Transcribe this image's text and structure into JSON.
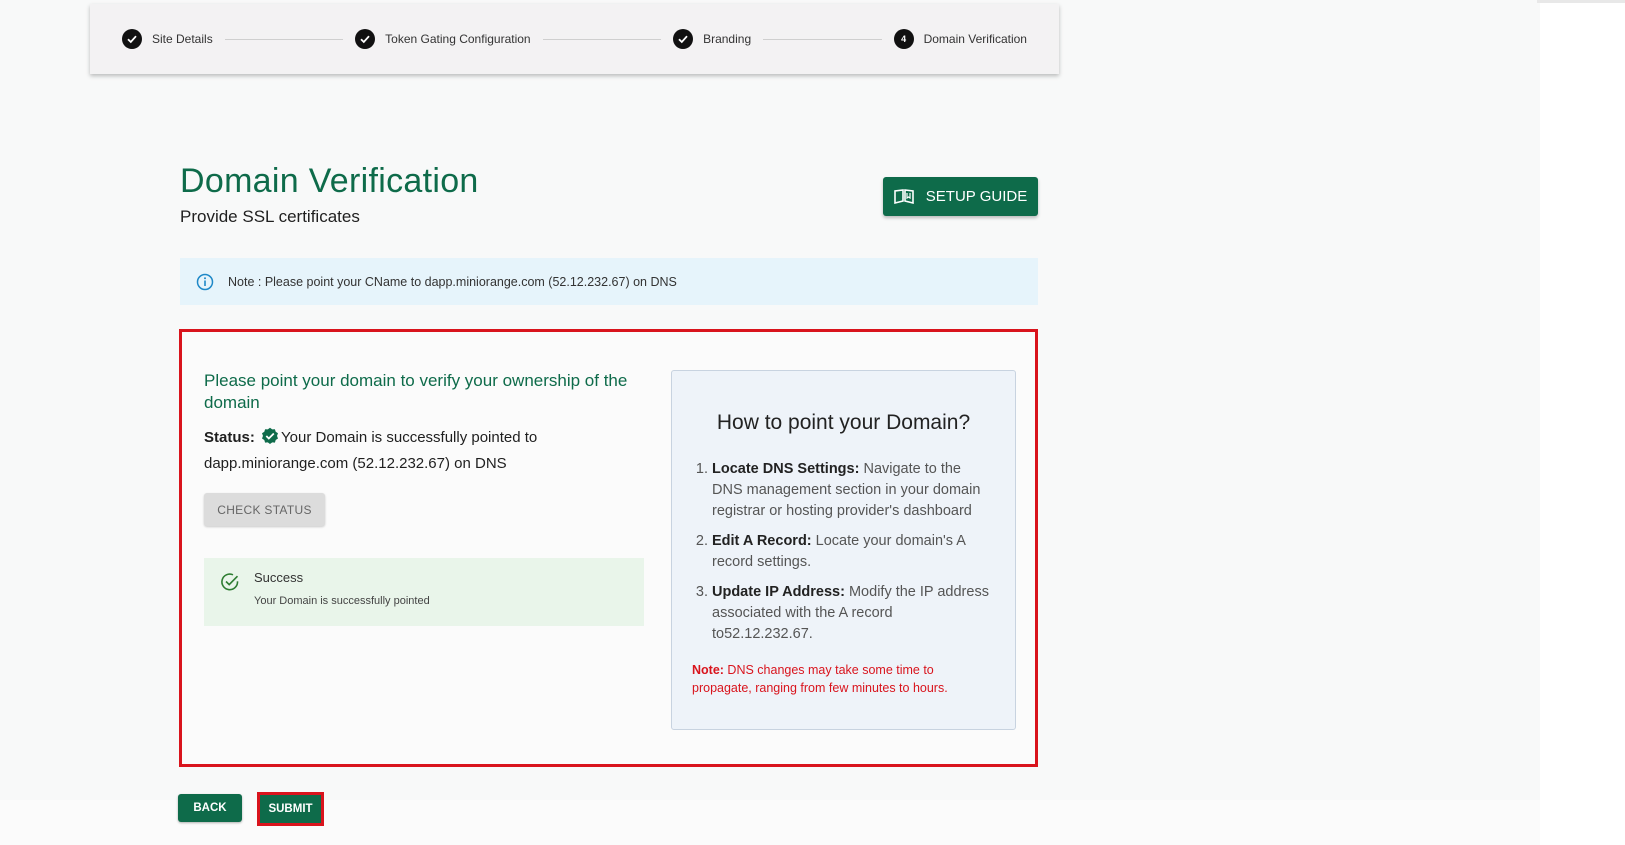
{
  "stepper": {
    "steps": [
      {
        "label": "Site Details",
        "state": "done"
      },
      {
        "label": "Token Gating Configuration",
        "state": "done"
      },
      {
        "label": "Branding",
        "state": "done"
      },
      {
        "label": "Domain Verification",
        "state": "current",
        "number": "4"
      }
    ]
  },
  "header": {
    "title": "Domain Verification",
    "subtitle": "Provide SSL certificates",
    "setup_guide_label": "SETUP GUIDE"
  },
  "note_banner": {
    "text": "Note : Please point your CName to dapp.miniorange.com (52.12.232.67) on DNS"
  },
  "verify_panel": {
    "heading": "Please point your domain to verify your ownership of the domain",
    "status_label": "Status:",
    "status_text": "Your Domain is successfully pointed to dapp.miniorange.com (52.12.232.67) on DNS",
    "check_status_label": "CHECK STATUS",
    "alert_title": "Success",
    "alert_message": "Your Domain is successfully pointed"
  },
  "guide_card": {
    "title": "How to point your Domain?",
    "items": [
      {
        "bold": "Locate DNS Settings:",
        "text": " Navigate to the DNS management section in your domain registrar or hosting provider's dashboard"
      },
      {
        "bold": "Edit A Record:",
        "text": " Locate your domain's A record settings."
      },
      {
        "bold": "Update IP Address:",
        "text": " Modify the IP address associated with the A record to52.12.232.67."
      }
    ],
    "note_label": "Note:",
    "note_text": " DNS changes may take some time to propagate, ranging from few minutes to hours."
  },
  "footer": {
    "back_label": "BACK",
    "submit_label": "SUBMIT"
  },
  "colors": {
    "brand_green": "#0e6b4a",
    "highlight_red": "#d9141d",
    "info_bg": "#e6f4fb",
    "success_bg": "#e9f5ea"
  }
}
